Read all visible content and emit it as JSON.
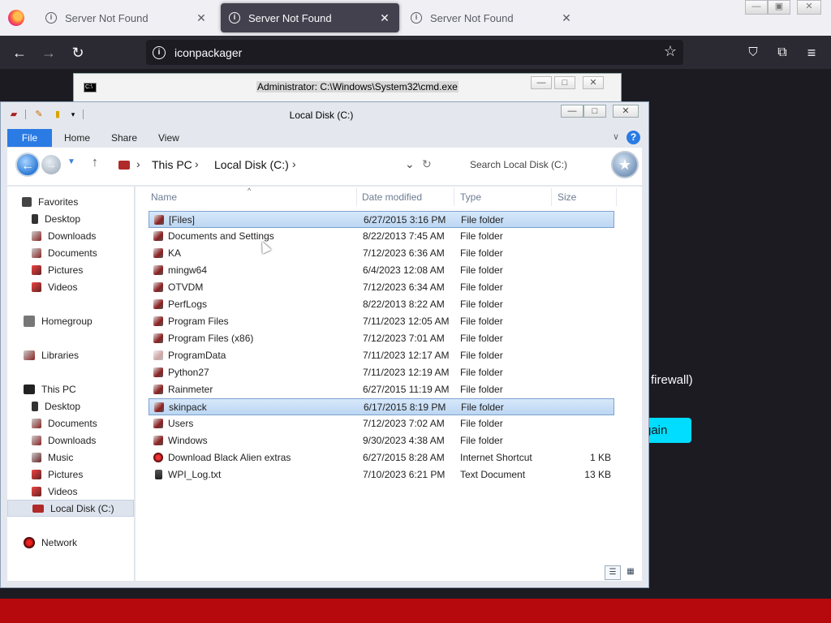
{
  "browser": {
    "tabs": [
      {
        "title": "Server Not Found",
        "active": false
      },
      {
        "title": "Server Not Found",
        "active": true
      },
      {
        "title": "Server Not Found",
        "active": false
      }
    ],
    "url": "iconpackager",
    "tab_close_glyph": "✕"
  },
  "page": {
    "partial_text": "firewall)",
    "partial_button": "gain"
  },
  "cmd": {
    "title": "Administrator: C:\\Windows\\System32\\cmd.exe",
    "icon_text": "C:\\"
  },
  "explorer": {
    "title": "Local Disk (C:)",
    "ribbon_tabs": [
      "File",
      "Home",
      "Share",
      "View"
    ],
    "breadcrumb": [
      "This PC",
      "Local Disk (C:)"
    ],
    "search_placeholder": "Search Local Disk (C:)",
    "columns": [
      "Name",
      "Date modified",
      "Type",
      "Size"
    ],
    "nav": {
      "favorites": "Favorites",
      "favorites_items": [
        "Desktop",
        "Downloads",
        "Documents",
        "Pictures",
        "Videos"
      ],
      "homegroup": "Homegroup",
      "libraries": "Libraries",
      "this_pc": "This PC",
      "this_pc_items": [
        "Desktop",
        "Documents",
        "Downloads",
        "Music",
        "Pictures",
        "Videos",
        "Local Disk (C:)"
      ],
      "network": "Network"
    },
    "files": [
      {
        "name": "[Files]",
        "date": "6/27/2015 3:16 PM",
        "type": "File folder",
        "size": "",
        "selected": true,
        "icon": "folder"
      },
      {
        "name": "Documents and Settings",
        "date": "8/22/2013 7:45 AM",
        "type": "File folder",
        "size": "",
        "selected": false,
        "icon": "folder-link"
      },
      {
        "name": "KA",
        "date": "7/12/2023 6:36 AM",
        "type": "File folder",
        "size": "",
        "selected": false,
        "icon": "folder"
      },
      {
        "name": "mingw64",
        "date": "6/4/2023 12:08 AM",
        "type": "File folder",
        "size": "",
        "selected": false,
        "icon": "folder"
      },
      {
        "name": "OTVDM",
        "date": "7/12/2023 6:34 AM",
        "type": "File folder",
        "size": "",
        "selected": false,
        "icon": "folder"
      },
      {
        "name": "PerfLogs",
        "date": "8/22/2013 8:22 AM",
        "type": "File folder",
        "size": "",
        "selected": false,
        "icon": "folder"
      },
      {
        "name": "Program Files",
        "date": "7/11/2023 12:05 AM",
        "type": "File folder",
        "size": "",
        "selected": false,
        "icon": "folder"
      },
      {
        "name": "Program Files (x86)",
        "date": "7/12/2023 7:01 AM",
        "type": "File folder",
        "size": "",
        "selected": false,
        "icon": "folder"
      },
      {
        "name": "ProgramData",
        "date": "7/11/2023 12:17 AM",
        "type": "File folder",
        "size": "",
        "selected": false,
        "icon": "folder-hidden"
      },
      {
        "name": "Python27",
        "date": "7/11/2023 12:19 AM",
        "type": "File folder",
        "size": "",
        "selected": false,
        "icon": "folder"
      },
      {
        "name": "Rainmeter",
        "date": "6/27/2015 11:19 AM",
        "type": "File folder",
        "size": "",
        "selected": false,
        "icon": "folder"
      },
      {
        "name": "skinpack",
        "date": "6/17/2015 8:19 PM",
        "type": "File folder",
        "size": "",
        "selected": true,
        "icon": "folder"
      },
      {
        "name": "Users",
        "date": "7/12/2023 7:02 AM",
        "type": "File folder",
        "size": "",
        "selected": false,
        "icon": "folder"
      },
      {
        "name": "Windows",
        "date": "9/30/2023 4:38 AM",
        "type": "File folder",
        "size": "",
        "selected": false,
        "icon": "folder"
      },
      {
        "name": "Download Black Alien extras",
        "date": "6/27/2015 8:28 AM",
        "type": "Internet Shortcut",
        "size": "1 KB",
        "selected": false,
        "icon": "internet-shortcut"
      },
      {
        "name": "WPI_Log.txt",
        "date": "7/10/2023 6:21 PM",
        "type": "Text Document",
        "size": "13 KB",
        "selected": false,
        "icon": "text-document"
      }
    ]
  }
}
